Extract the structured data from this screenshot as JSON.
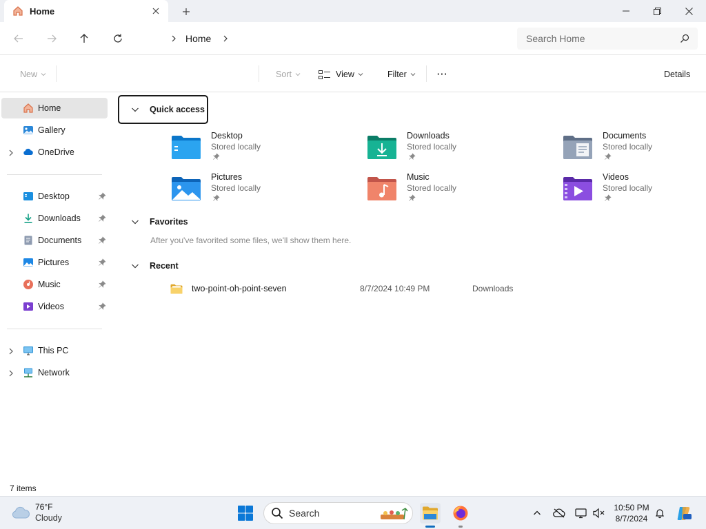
{
  "tab": {
    "title": "Home"
  },
  "address": {
    "crumb": "Home"
  },
  "search": {
    "placeholder": "Search Home"
  },
  "commands": {
    "new": "New",
    "sort": "Sort",
    "view": "View",
    "filter": "Filter",
    "more": "···",
    "details": "Details"
  },
  "sidebar": {
    "top": [
      {
        "label": "Home",
        "icon": "home-icon"
      },
      {
        "label": "Gallery",
        "icon": "gallery-icon"
      },
      {
        "label": "OneDrive",
        "icon": "onedrive-icon"
      }
    ],
    "pinned": [
      {
        "label": "Desktop",
        "icon": "desktop-folder-icon"
      },
      {
        "label": "Downloads",
        "icon": "download-icon"
      },
      {
        "label": "Documents",
        "icon": "documents-icon"
      },
      {
        "label": "Pictures",
        "icon": "pictures-icon"
      },
      {
        "label": "Music",
        "icon": "music-icon"
      },
      {
        "label": "Videos",
        "icon": "videos-icon"
      }
    ],
    "bottom": [
      {
        "label": "This PC",
        "icon": "pc-icon"
      },
      {
        "label": "Network",
        "icon": "network-icon"
      }
    ]
  },
  "quick_access": {
    "title": "Quick access",
    "items": [
      {
        "name": "Desktop",
        "sub": "Stored locally",
        "icon": "desktop-folder-icon",
        "color": "#1a8fe0"
      },
      {
        "name": "Downloads",
        "sub": "Stored locally",
        "icon": "downloads-folder-icon",
        "color": "#13a085"
      },
      {
        "name": "Documents",
        "sub": "Stored locally",
        "icon": "documents-folder-icon",
        "color": "#7f8fa6"
      },
      {
        "name": "Pictures",
        "sub": "Stored locally",
        "icon": "pictures-folder-icon",
        "color": "#1e88e5"
      },
      {
        "name": "Music",
        "sub": "Stored locally",
        "icon": "music-folder-icon",
        "color": "#e8705a"
      },
      {
        "name": "Videos",
        "sub": "Stored locally",
        "icon": "videos-folder-icon",
        "color": "#7b3fd0"
      }
    ]
  },
  "favorites": {
    "title": "Favorites",
    "empty_message": "After you've favorited some files, we'll show them here."
  },
  "recent": {
    "title": "Recent",
    "items": [
      {
        "name": "two-point-oh-point-seven",
        "date": "8/7/2024 10:49 PM",
        "location": "Downloads",
        "icon": "folder-icon"
      }
    ]
  },
  "status": {
    "items": "7 items"
  },
  "taskbar": {
    "weather": {
      "temp": "76°F",
      "condition": "Cloudy"
    },
    "search_label": "Search",
    "clock": {
      "time": "10:50 PM",
      "date": "8/7/2024"
    }
  },
  "colors": {
    "accent": "#0f6cbd",
    "selection": "#e5e5e5"
  }
}
